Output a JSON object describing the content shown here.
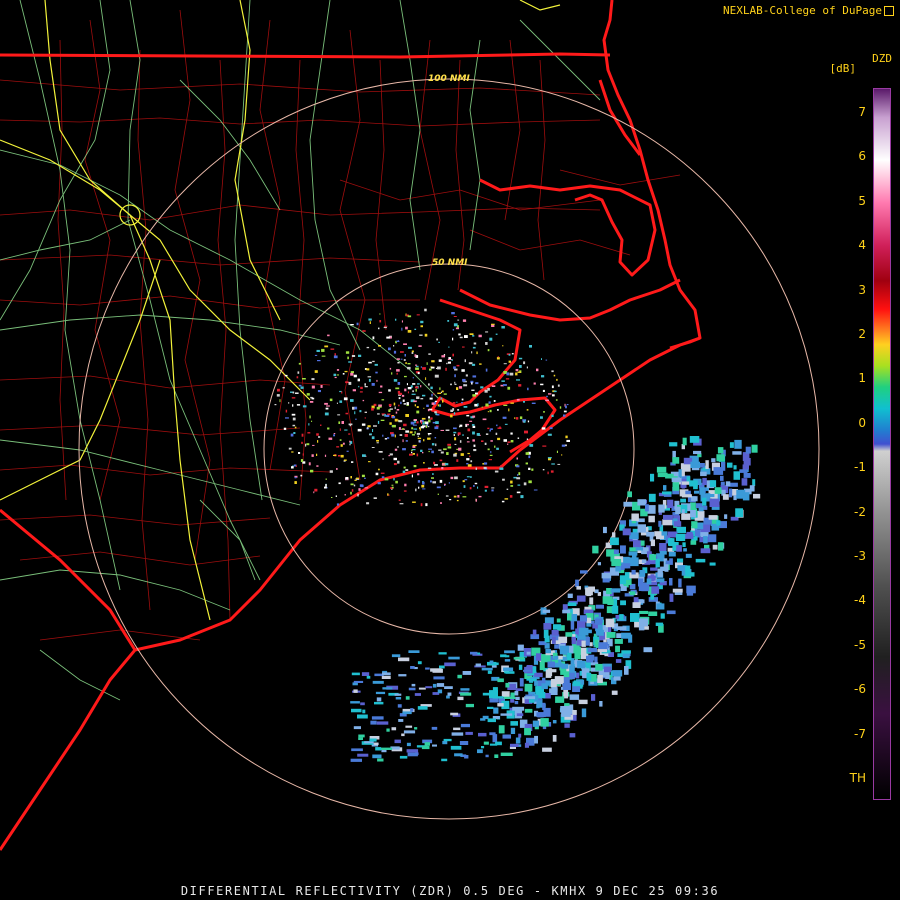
{
  "credit": {
    "text": "NEXLAB-College of DuPage"
  },
  "footer": {
    "text": "DIFFERENTIAL REFLECTIVITY (ZDR) 0.5 DEG - KMHX 9 DEC 25 09:36"
  },
  "range_rings": [
    {
      "label": "50 NMI"
    },
    {
      "label": "100 NMI"
    }
  ],
  "colorbar": {
    "product": "DZD",
    "units": "[dB]",
    "ticks": [
      "7",
      "6",
      "5",
      "4",
      "3",
      "2",
      "1",
      "0",
      "-1",
      "-2",
      "-3",
      "-4",
      "-5",
      "-6",
      "-7",
      "TH"
    ]
  },
  "colors": {
    "state_borders": "#ff1a1a",
    "county_lines": "#c01010",
    "highways_green": "#8fe08f",
    "interstates_yellow": "#f2f23a",
    "range_rings": "#e8b8a8",
    "labels": "#ffd21a"
  }
}
